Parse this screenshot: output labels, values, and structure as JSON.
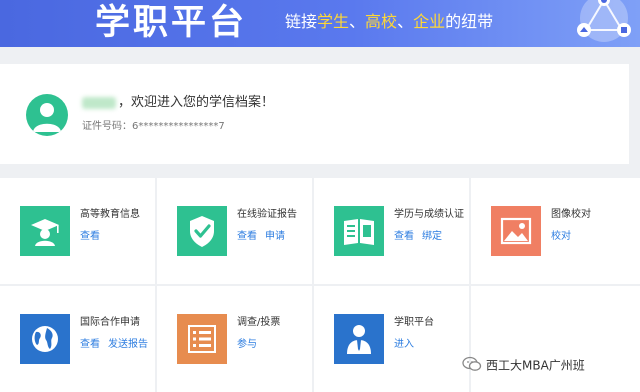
{
  "banner": {
    "brand": "学职平台",
    "slogan": {
      "p1": "链接",
      "h1": "学生",
      "s1": "、",
      "h2": "高校",
      "s2": "、",
      "h3": "企业",
      "p2": "的纽带"
    },
    "logo_icon": "platform-network-logo",
    "colors": {
      "bg": "#4a68e0",
      "highlight": "#ffd835"
    }
  },
  "profile": {
    "greeting": "，欢迎进入您的学信档案！",
    "id_label": "证件号码：",
    "id_value": "6****************7",
    "avatar_icon": "user-avatar-icon",
    "avatar_color": "#2ec191"
  },
  "services": [
    {
      "title": "高等教育信息",
      "links": [
        "查看"
      ],
      "icon": "graduate-icon",
      "color": "#2ec191"
    },
    {
      "title": "在线验证报告",
      "links": [
        "查看",
        "申请"
      ],
      "icon": "shield-check-icon",
      "color": "#2ec191"
    },
    {
      "title": "学历与成绩认证",
      "links": [
        "查看",
        "绑定"
      ],
      "icon": "certificate-icon",
      "color": "#2ec191"
    },
    {
      "title": "图像校对",
      "links": [
        "校对"
      ],
      "icon": "image-icon",
      "color": "#f07f63"
    },
    {
      "title": "国际合作申请",
      "links": [
        "查看",
        "发送报告"
      ],
      "icon": "globe-icon",
      "color": "#2a73cc"
    },
    {
      "title": "调查/投票",
      "links": [
        "参与"
      ],
      "icon": "survey-list-icon",
      "color": "#e78c4f"
    },
    {
      "title": "学职平台",
      "links": [
        "进入"
      ],
      "icon": "career-icon",
      "color": "#2a73cc"
    }
  ],
  "watermark": {
    "text": "西工大MBA广州班",
    "icon": "wechat-icon"
  }
}
